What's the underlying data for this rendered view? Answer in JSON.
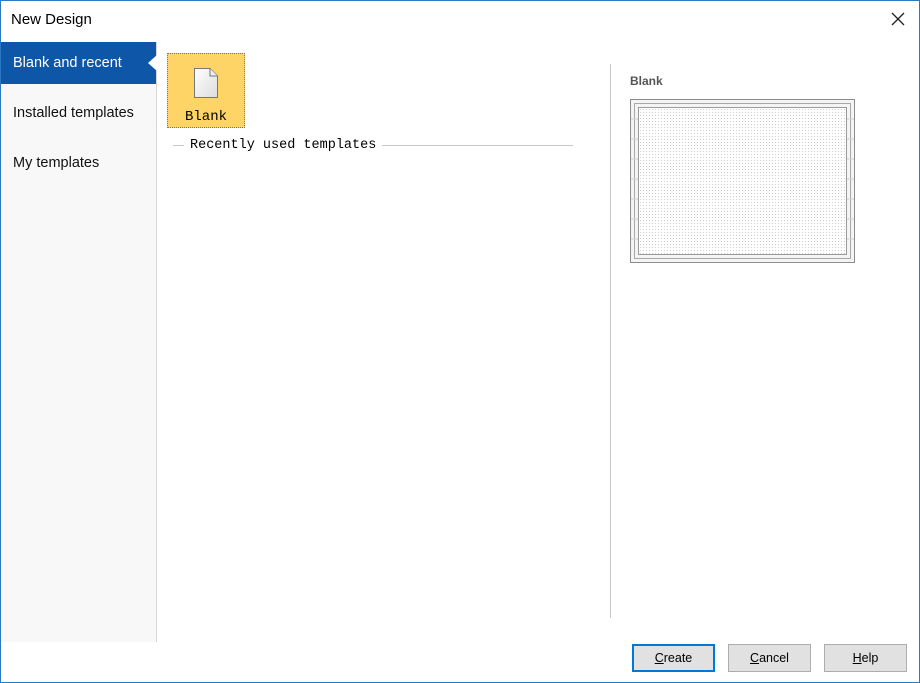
{
  "window": {
    "title": "New Design"
  },
  "icons": {
    "close": "close-icon",
    "document": "blank-document-icon"
  },
  "colors": {
    "sidebar_selected": "#0e56a8",
    "tile_selected": "#ffd466",
    "default_button_border": "#0078d7"
  },
  "sidebar": {
    "items": [
      {
        "label": "Blank and recent",
        "selected": true
      },
      {
        "label": "Installed templates",
        "selected": false
      },
      {
        "label": "My templates",
        "selected": false
      }
    ]
  },
  "main": {
    "tiles": [
      {
        "label": "Blank",
        "selected": true
      }
    ],
    "recent_group_label": "Recently used templates"
  },
  "preview": {
    "title": "Blank"
  },
  "footer": {
    "create": {
      "mnemonic": "C",
      "rest": "reate"
    },
    "cancel": {
      "mnemonic": "C",
      "rest": "ancel"
    },
    "help": {
      "mnemonic": "H",
      "rest": "elp"
    }
  }
}
